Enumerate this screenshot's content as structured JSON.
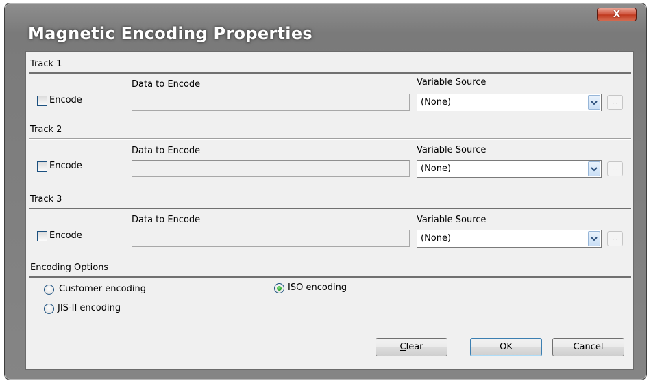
{
  "window": {
    "title": "Magnetic Encoding Properties",
    "close_glyph": "X"
  },
  "tracks": [
    {
      "title": "Track 1",
      "encode_label": "Encode",
      "encode_checked": false,
      "data_label": "Data to Encode",
      "data_value": "",
      "var_label": "Variable Source",
      "var_value": "(None)",
      "browse_label": "..."
    },
    {
      "title": "Track 2",
      "encode_label": "Encode",
      "encode_checked": false,
      "data_label": "Data to Encode",
      "data_value": "",
      "var_label": "Variable Source",
      "var_value": "(None)",
      "browse_label": "..."
    },
    {
      "title": "Track 3",
      "encode_label": "Encode",
      "encode_checked": false,
      "data_label": "Data to Encode",
      "data_value": "",
      "var_label": "Variable Source",
      "var_value": "(None)",
      "browse_label": "..."
    }
  ],
  "encoding_options": {
    "title": "Encoding Options",
    "customer": {
      "label": "Customer encoding",
      "checked": false
    },
    "iso": {
      "label": "ISO encoding",
      "checked": true
    },
    "jis": {
      "label": "JIS-II encoding",
      "checked": false
    }
  },
  "buttons": {
    "clear_mnemonic": "C",
    "clear_rest": "lear",
    "ok": "OK",
    "cancel": "Cancel"
  },
  "icons": {
    "dropdown": "chevron-down-icon",
    "radio_selected_color": "#1f9c1f"
  }
}
